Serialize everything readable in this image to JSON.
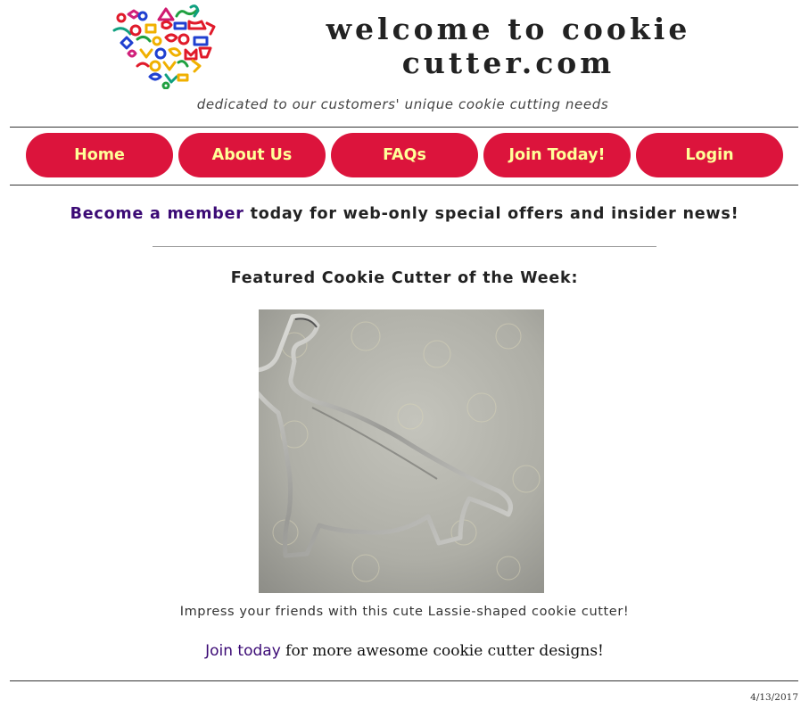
{
  "header": {
    "title": "welcome to cookie cutter.com",
    "tagline": "dedicated to our customers' unique cookie cutting needs"
  },
  "nav": {
    "items": [
      {
        "label": "Home"
      },
      {
        "label": "About Us"
      },
      {
        "label": "FAQs"
      },
      {
        "label": "Join Today!"
      },
      {
        "label": "Login"
      }
    ]
  },
  "promo": {
    "link_text": "Become a member",
    "rest": " today for web-only special offers and insider news!"
  },
  "featured": {
    "title": "Featured Cookie Cutter of the Week:",
    "caption": "Impress your friends with this cute Lassie-shaped cookie cutter!"
  },
  "join": {
    "link_text": "Join today",
    "rest": " for more awesome cookie cutter designs!"
  },
  "footer": {
    "date": "4/13/2017"
  },
  "colors": {
    "nav_bg": "#dc143c",
    "nav_text": "#ffff99",
    "link": "#3b0a75"
  }
}
